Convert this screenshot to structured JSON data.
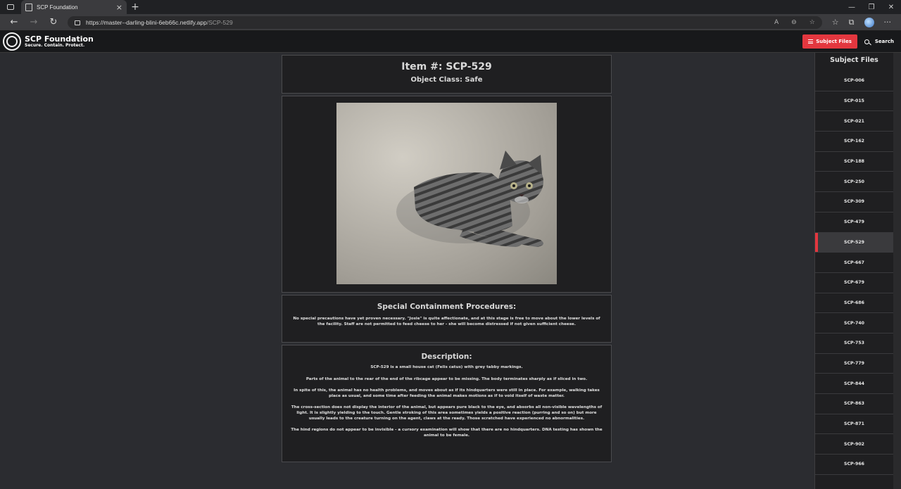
{
  "browser": {
    "tab_title": "SCP Foundation",
    "url_host": "https://master--darling-blini-6eb66c.netlify.app",
    "url_path": "/SCP-529"
  },
  "header": {
    "brand_name": "SCP Foundation",
    "brand_tagline": "Secure. Contain. Protect.",
    "subject_files_label": "Subject Files",
    "search_label": "Search",
    "accent_color": "#e3373f"
  },
  "item": {
    "title": "Item #: SCP-529",
    "object_class": "Object Class: Safe",
    "image_subject": "grey tabby kitten lying on concrete"
  },
  "containment": {
    "heading": "Special Containment Procedures:",
    "text": "No special precautions have yet proven necessary. \"Josie\" is quite affectionate, and at this stage is free to move about the lower levels of the facility. Staff are not permitted to feed cheese to her - she will become distressed if not given sufficient cheese."
  },
  "description": {
    "heading": "Description:",
    "paragraphs": [
      "SCP-529 is a small house cat (Felis catus) with grey tabby markings.",
      "Parts of the animal to the rear of the end of the ribcage appear to be missing. The body terminates sharply as if sliced in two.",
      "In spite of this, the animal has no health problems, and moves about as if its hindquarters were still in place. For example, walking takes place as usual, and some time after feeding the animal makes motions as if to void itself of waste matter.",
      "The cross-section does not display the interior of the animal, but appears pure black to the eye, and absorbs all non-visible wavelengths of light. It is slightly yielding to the touch. Gentle stroking of this area sometimes yields a positive reaction (purring and so on) but more usually leads to the creature turning on the agent, claws at the ready. Those scratched have experienced no abnormalities.",
      "The hind regions do not appear to be invisible - a cursory examination will show that there are no hindquarters. DNA testing has shown the animal to be female."
    ]
  },
  "sidebar": {
    "title": "Subject Files",
    "active": "SCP-529",
    "items": [
      "SCP-006",
      "SCP-015",
      "SCP-021",
      "SCP-162",
      "SCP-188",
      "SCP-250",
      "SCP-309",
      "SCP-479",
      "SCP-529",
      "SCP-667",
      "SCP-679",
      "SCP-686",
      "SCP-740",
      "SCP-753",
      "SCP-779",
      "SCP-844",
      "SCP-863",
      "SCP-871",
      "SCP-902",
      "SCP-966"
    ]
  }
}
